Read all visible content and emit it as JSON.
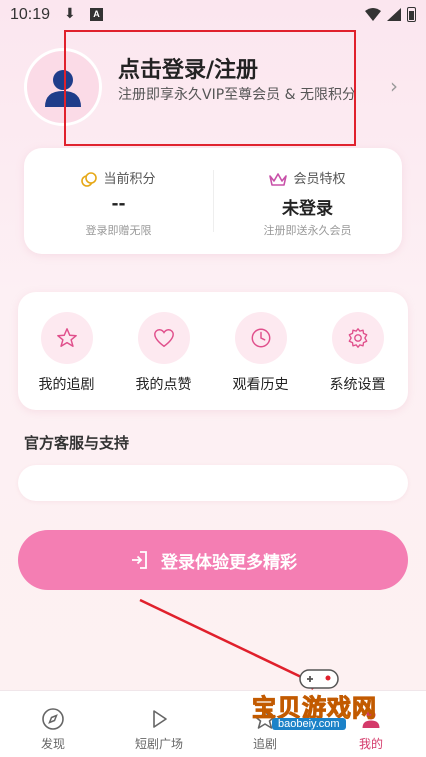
{
  "status_bar": {
    "time": "10:19"
  },
  "profile": {
    "title": "点击登录/注册",
    "subtitle": "注册即享永久VIP至尊会员 & 无限积分"
  },
  "stats": {
    "points": {
      "label": "当前积分",
      "value": "--",
      "note": "登录即赠无限"
    },
    "vip": {
      "label": "会员特权",
      "value": "未登录",
      "note": "注册即送永久会员"
    }
  },
  "menu": [
    {
      "label": "我的追剧",
      "icon": "star-icon"
    },
    {
      "label": "我的点赞",
      "icon": "heart-icon"
    },
    {
      "label": "观看历史",
      "icon": "clock-icon"
    },
    {
      "label": "系统设置",
      "icon": "gear-icon"
    }
  ],
  "support": {
    "title": "官方客服与支持"
  },
  "login_button": {
    "label": "登录体验更多精彩"
  },
  "tabbar": [
    {
      "label": "发现",
      "icon": "compass-icon"
    },
    {
      "label": "短剧广场",
      "icon": "play-icon"
    },
    {
      "label": "追剧",
      "icon": "star-icon"
    },
    {
      "label": "我的",
      "icon": "user-icon",
      "active": true
    }
  ],
  "watermark": {
    "text": "宝贝游戏网",
    "url": "baobeiy.com"
  },
  "colors": {
    "accent": "#f47eb3",
    "active_tab": "#d43a6a",
    "annotation": "#e0202c"
  }
}
